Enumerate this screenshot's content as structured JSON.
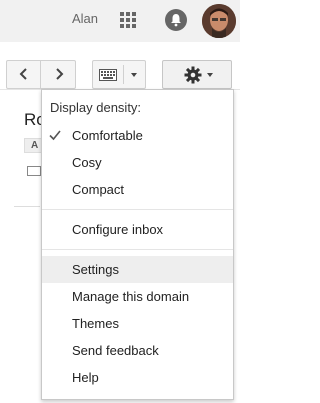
{
  "header": {
    "user_name": "Alan",
    "apps_icon": "apps-grid-icon",
    "notifications_icon": "bell-icon"
  },
  "toolbar": {
    "prev_icon": "chevron-left-icon",
    "next_icon": "chevron-right-icon",
    "input_tools_icon": "keyboard-icon",
    "settings_icon": "gear-icon"
  },
  "background": {
    "title_fragment": "Ro",
    "chip_fragment": "A"
  },
  "menu": {
    "density_header": "Display density:",
    "density_options": [
      "Comfortable",
      "Cosy",
      "Compact"
    ],
    "selected_density": "Comfortable",
    "configure_inbox": "Configure inbox",
    "items": [
      "Settings",
      "Manage this domain",
      "Themes",
      "Send feedback",
      "Help"
    ],
    "highlighted_item": "Settings"
  }
}
